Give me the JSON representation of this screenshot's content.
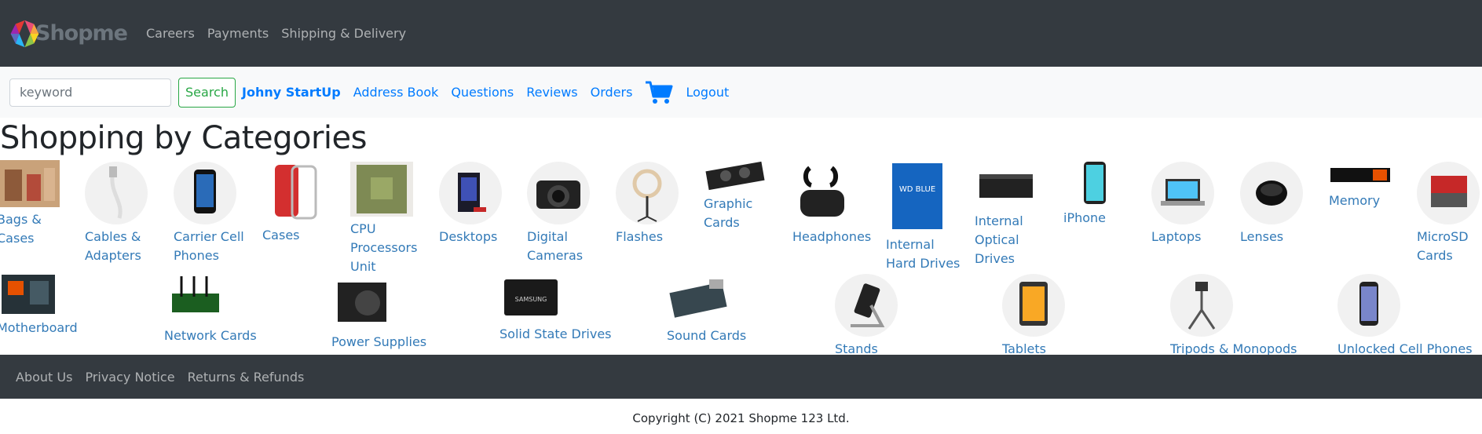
{
  "brand": {
    "name": "Shopme"
  },
  "top_nav": [
    "Careers",
    "Payments",
    "Shipping & Delivery"
  ],
  "search": {
    "placeholder": "keyword",
    "button": "Search"
  },
  "user_nav": {
    "user": "Johny StartUp",
    "links": [
      "Address Book",
      "Questions",
      "Reviews",
      "Orders"
    ],
    "logout": "Logout"
  },
  "icons": {
    "cart": "shopping-cart-icon",
    "logo": "shopme-logo-icon"
  },
  "colors": {
    "dark": "#343a40",
    "link": "#007bff",
    "success": "#28a745"
  },
  "page_title": "Shopping by Categories",
  "categories": [
    {
      "label": "Bags & Cases",
      "lines": [
        "Bags &",
        "Cases"
      ]
    },
    {
      "label": "Cables & Adapters",
      "lines": [
        "Cables &",
        "Adapters"
      ]
    },
    {
      "label": "Carrier Cell Phones",
      "lines": [
        "Carrier Cell",
        "Phones"
      ]
    },
    {
      "label": "Cases",
      "lines": [
        "Cases"
      ]
    },
    {
      "label": "CPU Processors Unit",
      "lines": [
        "CPU",
        "Processors",
        "Unit"
      ]
    },
    {
      "label": "Desktops",
      "lines": [
        "Desktops"
      ]
    },
    {
      "label": "Digital Cameras",
      "lines": [
        "Digital",
        "Cameras"
      ]
    },
    {
      "label": "Flashes",
      "lines": [
        "Flashes"
      ]
    },
    {
      "label": "Graphic Cards",
      "lines": [
        "Graphic",
        "Cards"
      ]
    },
    {
      "label": "Headphones",
      "lines": [
        "Headphones"
      ]
    },
    {
      "label": "Internal Hard Drives",
      "lines": [
        "Internal",
        "Hard Drives"
      ]
    },
    {
      "label": "Internal Optical Drives",
      "lines": [
        "Internal",
        "Optical",
        "Drives"
      ]
    },
    {
      "label": "iPhone",
      "lines": [
        "iPhone"
      ]
    },
    {
      "label": "Laptops",
      "lines": [
        "Laptops"
      ]
    },
    {
      "label": "Lenses",
      "lines": [
        "Lenses"
      ]
    },
    {
      "label": "Memory",
      "lines": [
        "Memory"
      ]
    },
    {
      "label": "MicroSD Cards",
      "lines": [
        "MicroSD",
        "Cards"
      ]
    },
    {
      "label": "Motherboard",
      "lines": [
        "Motherboard"
      ]
    },
    {
      "label": "Network Cards",
      "lines": [
        "Network Cards"
      ]
    },
    {
      "label": "Power Supplies",
      "lines": [
        "Power Supplies"
      ]
    },
    {
      "label": "Solid State Drives",
      "lines": [
        "Solid State Drives"
      ]
    },
    {
      "label": "Sound Cards",
      "lines": [
        "Sound Cards"
      ]
    },
    {
      "label": "Stands",
      "lines": [
        "Stands"
      ]
    },
    {
      "label": "Tablets",
      "lines": [
        "Tablets"
      ]
    },
    {
      "label": "Tripods & Monopods",
      "lines": [
        "Tripods & Monopods"
      ]
    },
    {
      "label": "Unlocked Cell Phones",
      "lines": [
        "Unlocked Cell Phones"
      ]
    }
  ],
  "footer": {
    "links": [
      "About Us",
      "Privacy Notice",
      "Returns & Refunds"
    ],
    "copyright": "Copyright (C) 2021 Shopme 123 Ltd."
  }
}
